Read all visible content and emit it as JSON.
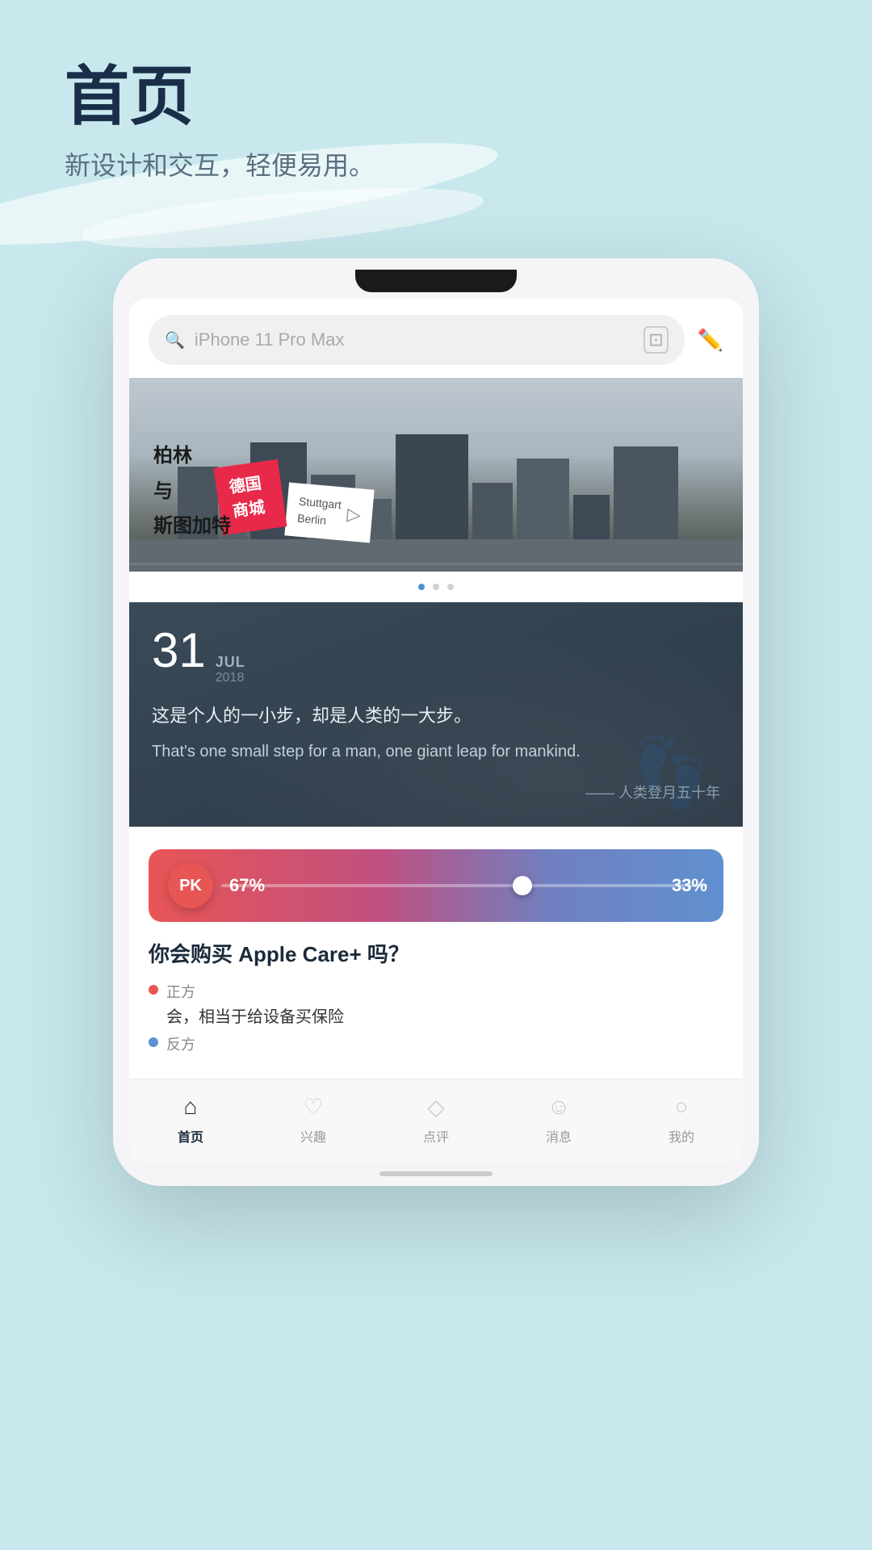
{
  "page": {
    "background_color": "#c8e8ed",
    "header": {
      "title": "首页",
      "subtitle": "新设计和交互，轻便易用。"
    }
  },
  "phone": {
    "search": {
      "placeholder": "iPhone 11 Pro Max",
      "scan_label": "scan",
      "edit_label": "edit"
    },
    "banner": {
      "image_alt": "Berlin street scene",
      "postcard_red_text": "德国\n商城",
      "postcard_chinese": "柏林\n与\n斯图加特",
      "postcard_white_text": "Stuttgart\nBerlin",
      "dots": [
        "active",
        "inactive",
        "inactive"
      ]
    },
    "quote": {
      "day": "31",
      "month": "JUL",
      "year": "2018",
      "text_cn": "这是个人的一小步，却是人类的一大步。",
      "text_en": "That's one small step for a man, one giant leap for mankind.",
      "source": "—— 人类登月五十年"
    },
    "pk_card": {
      "badge_label": "PK",
      "percent_left": "67%",
      "percent_right": "33%",
      "question": "你会购买 Apple Care+ 吗？",
      "side_positive_label": "正方",
      "side_positive_content": "会，相当于给设备买保险",
      "side_negative_label": "反方",
      "side_negative_content": ""
    },
    "bottom_nav": {
      "items": [
        {
          "icon": "🏠",
          "label": "首页",
          "active": true
        },
        {
          "icon": "♡",
          "label": "兴趣",
          "active": false
        },
        {
          "icon": "◇",
          "label": "点评",
          "active": false
        },
        {
          "icon": "☺",
          "label": "消息",
          "active": false
        },
        {
          "icon": "○",
          "label": "我的",
          "active": false
        }
      ]
    }
  }
}
